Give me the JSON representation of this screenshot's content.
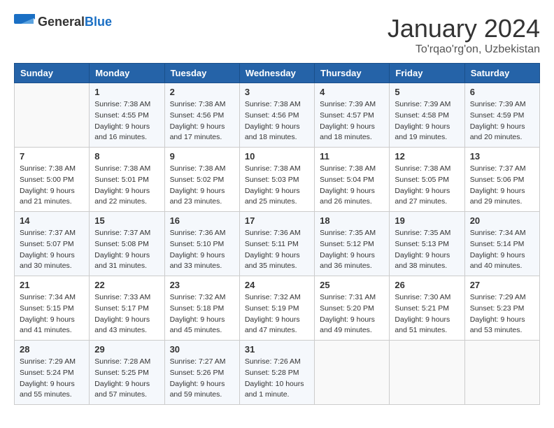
{
  "header": {
    "logo_general": "General",
    "logo_blue": "Blue",
    "title": "January 2024",
    "subtitle": "To'rqao'rg'on, Uzbekistan"
  },
  "weekdays": [
    "Sunday",
    "Monday",
    "Tuesday",
    "Wednesday",
    "Thursday",
    "Friday",
    "Saturday"
  ],
  "weeks": [
    [
      {
        "day": "",
        "info": ""
      },
      {
        "day": "1",
        "info": "Sunrise: 7:38 AM\nSunset: 4:55 PM\nDaylight: 9 hours\nand 16 minutes."
      },
      {
        "day": "2",
        "info": "Sunrise: 7:38 AM\nSunset: 4:56 PM\nDaylight: 9 hours\nand 17 minutes."
      },
      {
        "day": "3",
        "info": "Sunrise: 7:38 AM\nSunset: 4:56 PM\nDaylight: 9 hours\nand 18 minutes."
      },
      {
        "day": "4",
        "info": "Sunrise: 7:39 AM\nSunset: 4:57 PM\nDaylight: 9 hours\nand 18 minutes."
      },
      {
        "day": "5",
        "info": "Sunrise: 7:39 AM\nSunset: 4:58 PM\nDaylight: 9 hours\nand 19 minutes."
      },
      {
        "day": "6",
        "info": "Sunrise: 7:39 AM\nSunset: 4:59 PM\nDaylight: 9 hours\nand 20 minutes."
      }
    ],
    [
      {
        "day": "7",
        "info": "Sunrise: 7:38 AM\nSunset: 5:00 PM\nDaylight: 9 hours\nand 21 minutes."
      },
      {
        "day": "8",
        "info": "Sunrise: 7:38 AM\nSunset: 5:01 PM\nDaylight: 9 hours\nand 22 minutes."
      },
      {
        "day": "9",
        "info": "Sunrise: 7:38 AM\nSunset: 5:02 PM\nDaylight: 9 hours\nand 23 minutes."
      },
      {
        "day": "10",
        "info": "Sunrise: 7:38 AM\nSunset: 5:03 PM\nDaylight: 9 hours\nand 25 minutes."
      },
      {
        "day": "11",
        "info": "Sunrise: 7:38 AM\nSunset: 5:04 PM\nDaylight: 9 hours\nand 26 minutes."
      },
      {
        "day": "12",
        "info": "Sunrise: 7:38 AM\nSunset: 5:05 PM\nDaylight: 9 hours\nand 27 minutes."
      },
      {
        "day": "13",
        "info": "Sunrise: 7:37 AM\nSunset: 5:06 PM\nDaylight: 9 hours\nand 29 minutes."
      }
    ],
    [
      {
        "day": "14",
        "info": "Sunrise: 7:37 AM\nSunset: 5:07 PM\nDaylight: 9 hours\nand 30 minutes."
      },
      {
        "day": "15",
        "info": "Sunrise: 7:37 AM\nSunset: 5:08 PM\nDaylight: 9 hours\nand 31 minutes."
      },
      {
        "day": "16",
        "info": "Sunrise: 7:36 AM\nSunset: 5:10 PM\nDaylight: 9 hours\nand 33 minutes."
      },
      {
        "day": "17",
        "info": "Sunrise: 7:36 AM\nSunset: 5:11 PM\nDaylight: 9 hours\nand 35 minutes."
      },
      {
        "day": "18",
        "info": "Sunrise: 7:35 AM\nSunset: 5:12 PM\nDaylight: 9 hours\nand 36 minutes."
      },
      {
        "day": "19",
        "info": "Sunrise: 7:35 AM\nSunset: 5:13 PM\nDaylight: 9 hours\nand 38 minutes."
      },
      {
        "day": "20",
        "info": "Sunrise: 7:34 AM\nSunset: 5:14 PM\nDaylight: 9 hours\nand 40 minutes."
      }
    ],
    [
      {
        "day": "21",
        "info": "Sunrise: 7:34 AM\nSunset: 5:15 PM\nDaylight: 9 hours\nand 41 minutes."
      },
      {
        "day": "22",
        "info": "Sunrise: 7:33 AM\nSunset: 5:17 PM\nDaylight: 9 hours\nand 43 minutes."
      },
      {
        "day": "23",
        "info": "Sunrise: 7:32 AM\nSunset: 5:18 PM\nDaylight: 9 hours\nand 45 minutes."
      },
      {
        "day": "24",
        "info": "Sunrise: 7:32 AM\nSunset: 5:19 PM\nDaylight: 9 hours\nand 47 minutes."
      },
      {
        "day": "25",
        "info": "Sunrise: 7:31 AM\nSunset: 5:20 PM\nDaylight: 9 hours\nand 49 minutes."
      },
      {
        "day": "26",
        "info": "Sunrise: 7:30 AM\nSunset: 5:21 PM\nDaylight: 9 hours\nand 51 minutes."
      },
      {
        "day": "27",
        "info": "Sunrise: 7:29 AM\nSunset: 5:23 PM\nDaylight: 9 hours\nand 53 minutes."
      }
    ],
    [
      {
        "day": "28",
        "info": "Sunrise: 7:29 AM\nSunset: 5:24 PM\nDaylight: 9 hours\nand 55 minutes."
      },
      {
        "day": "29",
        "info": "Sunrise: 7:28 AM\nSunset: 5:25 PM\nDaylight: 9 hours\nand 57 minutes."
      },
      {
        "day": "30",
        "info": "Sunrise: 7:27 AM\nSunset: 5:26 PM\nDaylight: 9 hours\nand 59 minutes."
      },
      {
        "day": "31",
        "info": "Sunrise: 7:26 AM\nSunset: 5:28 PM\nDaylight: 10 hours\nand 1 minute."
      },
      {
        "day": "",
        "info": ""
      },
      {
        "day": "",
        "info": ""
      },
      {
        "day": "",
        "info": ""
      }
    ]
  ]
}
